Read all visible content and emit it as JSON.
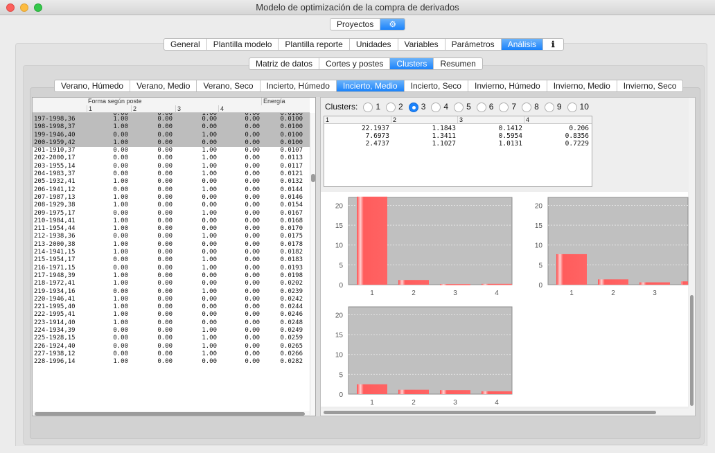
{
  "window": {
    "title": "Modelo de optimización de la compra de derivados"
  },
  "top_tabs": [
    {
      "label": "Proyectos",
      "selected": false
    },
    {
      "label": "⚙",
      "selected": true
    }
  ],
  "main_tabs": [
    {
      "label": "General",
      "selected": false
    },
    {
      "label": "Plantilla modelo",
      "selected": false
    },
    {
      "label": "Plantilla reporte",
      "selected": false
    },
    {
      "label": "Unidades",
      "selected": false
    },
    {
      "label": "Variables",
      "selected": false
    },
    {
      "label": "Parámetros",
      "selected": false
    },
    {
      "label": "Análisis",
      "selected": true
    },
    {
      "label": "ℹ",
      "selected": false
    }
  ],
  "sub_tabs": [
    {
      "label": "Matriz de datos",
      "selected": false
    },
    {
      "label": "Cortes y postes",
      "selected": false
    },
    {
      "label": "Clusters",
      "selected": true
    },
    {
      "label": "Resumen",
      "selected": false
    }
  ],
  "scenario_tabs": [
    {
      "label": "Verano, Húmedo",
      "selected": false
    },
    {
      "label": "Verano, Medio",
      "selected": false
    },
    {
      "label": "Verano, Seco",
      "selected": false
    },
    {
      "label": "Incierto, Húmedo",
      "selected": false
    },
    {
      "label": "Incierto, Medio",
      "selected": true
    },
    {
      "label": "Incierto, Seco",
      "selected": false
    },
    {
      "label": "Invierno, Húmedo",
      "selected": false
    },
    {
      "label": "Invierno, Medio",
      "selected": false
    },
    {
      "label": "Invierno, Seco",
      "selected": false
    }
  ],
  "data_table": {
    "group_header": "Forma según poste",
    "energy_header": "Energía",
    "columns": [
      "1",
      "2",
      "3",
      "4"
    ],
    "partial_top_row": [
      "",
      "0.00",
      "0.00",
      "1.00",
      "0.00",
      "0.0100"
    ],
    "rows": [
      {
        "id": "197-1998,36",
        "v": [
          "1.00",
          "0.00",
          "0.00",
          "0.00"
        ],
        "e": "0.0100",
        "hl": true
      },
      {
        "id": "198-1998,37",
        "v": [
          "1.00",
          "0.00",
          "0.00",
          "0.00"
        ],
        "e": "0.0100",
        "hl": true
      },
      {
        "id": "199-1946,40",
        "v": [
          "0.00",
          "0.00",
          "1.00",
          "0.00"
        ],
        "e": "0.0100",
        "hl": true
      },
      {
        "id": "200-1959,42",
        "v": [
          "1.00",
          "0.00",
          "0.00",
          "0.00"
        ],
        "e": "0.0100",
        "hl": true
      },
      {
        "id": "201-1910,37",
        "v": [
          "0.00",
          "0.00",
          "1.00",
          "0.00"
        ],
        "e": "0.0107",
        "hl": false
      },
      {
        "id": "202-2000,17",
        "v": [
          "0.00",
          "0.00",
          "1.00",
          "0.00"
        ],
        "e": "0.0113",
        "hl": false
      },
      {
        "id": "203-1955,14",
        "v": [
          "0.00",
          "0.00",
          "1.00",
          "0.00"
        ],
        "e": "0.0117",
        "hl": false
      },
      {
        "id": "204-1983,37",
        "v": [
          "0.00",
          "0.00",
          "1.00",
          "0.00"
        ],
        "e": "0.0121",
        "hl": false
      },
      {
        "id": "205-1932,41",
        "v": [
          "1.00",
          "0.00",
          "0.00",
          "0.00"
        ],
        "e": "0.0132",
        "hl": false
      },
      {
        "id": "206-1941,12",
        "v": [
          "0.00",
          "0.00",
          "1.00",
          "0.00"
        ],
        "e": "0.0144",
        "hl": false
      },
      {
        "id": "207-1987,13",
        "v": [
          "1.00",
          "0.00",
          "0.00",
          "0.00"
        ],
        "e": "0.0146",
        "hl": false
      },
      {
        "id": "208-1929,38",
        "v": [
          "1.00",
          "0.00",
          "0.00",
          "0.00"
        ],
        "e": "0.0154",
        "hl": false
      },
      {
        "id": "209-1975,17",
        "v": [
          "0.00",
          "0.00",
          "1.00",
          "0.00"
        ],
        "e": "0.0167",
        "hl": false
      },
      {
        "id": "210-1984,41",
        "v": [
          "1.00",
          "0.00",
          "0.00",
          "0.00"
        ],
        "e": "0.0168",
        "hl": false
      },
      {
        "id": "211-1954,44",
        "v": [
          "1.00",
          "0.00",
          "0.00",
          "0.00"
        ],
        "e": "0.0170",
        "hl": false
      },
      {
        "id": "212-1938,36",
        "v": [
          "0.00",
          "0.00",
          "1.00",
          "0.00"
        ],
        "e": "0.0175",
        "hl": false
      },
      {
        "id": "213-2000,38",
        "v": [
          "1.00",
          "0.00",
          "0.00",
          "0.00"
        ],
        "e": "0.0178",
        "hl": false
      },
      {
        "id": "214-1941,15",
        "v": [
          "1.00",
          "0.00",
          "0.00",
          "0.00"
        ],
        "e": "0.0182",
        "hl": false
      },
      {
        "id": "215-1954,17",
        "v": [
          "0.00",
          "0.00",
          "1.00",
          "0.00"
        ],
        "e": "0.0183",
        "hl": false
      },
      {
        "id": "216-1971,15",
        "v": [
          "0.00",
          "0.00",
          "1.00",
          "0.00"
        ],
        "e": "0.0193",
        "hl": false
      },
      {
        "id": "217-1948,39",
        "v": [
          "1.00",
          "0.00",
          "0.00",
          "0.00"
        ],
        "e": "0.0198",
        "hl": false
      },
      {
        "id": "218-1972,41",
        "v": [
          "1.00",
          "0.00",
          "0.00",
          "0.00"
        ],
        "e": "0.0202",
        "hl": false
      },
      {
        "id": "219-1934,16",
        "v": [
          "0.00",
          "0.00",
          "1.00",
          "0.00"
        ],
        "e": "0.0239",
        "hl": false
      },
      {
        "id": "220-1946,41",
        "v": [
          "1.00",
          "0.00",
          "0.00",
          "0.00"
        ],
        "e": "0.0242",
        "hl": false
      },
      {
        "id": "221-1995,40",
        "v": [
          "1.00",
          "0.00",
          "0.00",
          "0.00"
        ],
        "e": "0.0244",
        "hl": false
      },
      {
        "id": "222-1995,41",
        "v": [
          "1.00",
          "0.00",
          "0.00",
          "0.00"
        ],
        "e": "0.0246",
        "hl": false
      },
      {
        "id": "223-1914,40",
        "v": [
          "1.00",
          "0.00",
          "0.00",
          "0.00"
        ],
        "e": "0.0248",
        "hl": false
      },
      {
        "id": "224-1934,39",
        "v": [
          "0.00",
          "0.00",
          "1.00",
          "0.00"
        ],
        "e": "0.0249",
        "hl": false
      },
      {
        "id": "225-1928,15",
        "v": [
          "0.00",
          "0.00",
          "1.00",
          "0.00"
        ],
        "e": "0.0259",
        "hl": false
      },
      {
        "id": "226-1924,40",
        "v": [
          "0.00",
          "0.00",
          "1.00",
          "0.00"
        ],
        "e": "0.0265",
        "hl": false
      },
      {
        "id": "227-1938,12",
        "v": [
          "0.00",
          "0.00",
          "1.00",
          "0.00"
        ],
        "e": "0.0266",
        "hl": false
      },
      {
        "id": "228-1996,14",
        "v": [
          "1.00",
          "0.00",
          "0.00",
          "0.00"
        ],
        "e": "0.0282",
        "hl": false
      }
    ]
  },
  "clusters": {
    "label": "Clusters:",
    "options": [
      "1",
      "2",
      "3",
      "4",
      "5",
      "6",
      "7",
      "8",
      "9",
      "10"
    ],
    "selected": "3"
  },
  "centroid_table": {
    "columns": [
      "1",
      "2",
      "3",
      "4"
    ],
    "rows": [
      [
        "22.1937",
        "1.1843",
        "0.1412",
        "0.206"
      ],
      [
        "7.6973",
        "1.3411",
        "0.5954",
        "0.8356"
      ],
      [
        "2.4737",
        "1.1027",
        "1.0131",
        "0.7229"
      ]
    ]
  },
  "chart_data": [
    {
      "type": "bar",
      "categories": [
        "1",
        "2",
        "3",
        "4"
      ],
      "values": [
        22.1937,
        1.1843,
        0.1412,
        0.206
      ],
      "ylim": [
        0,
        22
      ],
      "yticks": [
        0,
        5,
        10,
        15,
        20
      ],
      "grid": true,
      "bar_color": "#ff5c5c",
      "plot_bg": "#c0c0c0"
    },
    {
      "type": "bar",
      "categories": [
        "1",
        "2",
        "3",
        "4"
      ],
      "values": [
        7.6973,
        1.3411,
        0.5954,
        0.8356
      ],
      "ylim": [
        0,
        22
      ],
      "yticks": [
        0,
        5,
        10,
        15,
        20
      ],
      "grid": true,
      "bar_color": "#ff5c5c",
      "plot_bg": "#c0c0c0"
    },
    {
      "type": "bar",
      "categories": [
        "1",
        "2",
        "3",
        "4"
      ],
      "values": [
        2.4737,
        1.1027,
        1.0131,
        0.7229
      ],
      "ylim": [
        0,
        22
      ],
      "yticks": [
        0,
        5,
        10,
        15,
        20
      ],
      "grid": true,
      "bar_color": "#ff5c5c",
      "plot_bg": "#c0c0c0"
    }
  ]
}
